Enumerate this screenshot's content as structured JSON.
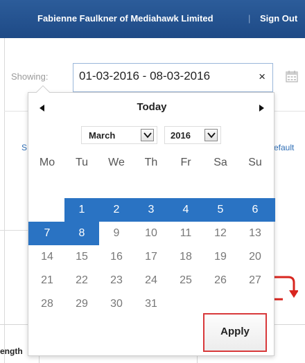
{
  "header": {
    "user_label": "Fabienne Faulkner of Mediahawk Limited",
    "separator": "|",
    "sign_out_label": "Sign Out"
  },
  "filter": {
    "showing_label": "Showing:",
    "date_range_value": "01-03-2016 - 08-03-2016",
    "clear_glyph": "×"
  },
  "background": {
    "left_link_fragment": "S",
    "right_link_fragment": "efault",
    "table_header_fragment": "ength"
  },
  "picker": {
    "today_label": "Today",
    "month_selected": "March",
    "year_selected": "2016",
    "weekdays": [
      "Mo",
      "Tu",
      "We",
      "Th",
      "Fr",
      "Sa",
      "Su"
    ],
    "weeks": [
      [
        "",
        "1",
        "2",
        "3",
        "4",
        "5",
        "6"
      ],
      [
        "7",
        "8",
        "9",
        "10",
        "11",
        "12",
        "13"
      ],
      [
        "14",
        "15",
        "16",
        "17",
        "18",
        "19",
        "20"
      ],
      [
        "21",
        "22",
        "23",
        "24",
        "25",
        "26",
        "27"
      ],
      [
        "28",
        "29",
        "30",
        "31",
        "",
        "",
        ""
      ]
    ],
    "selected_days": [
      "1",
      "2",
      "3",
      "4",
      "5",
      "6",
      "7",
      "8"
    ],
    "apply_label": "Apply"
  },
  "colors": {
    "header_bg": "#1e4a86",
    "selection": "#2a73c3",
    "apply_border": "#d8383a",
    "link": "#2d6db5",
    "arrow_red": "#d8261f"
  },
  "icons": [
    "calendar-icon",
    "arrow-left-icon",
    "arrow-right-icon",
    "chevron-down-icon",
    "close-icon",
    "flow-arrow-icon"
  ]
}
